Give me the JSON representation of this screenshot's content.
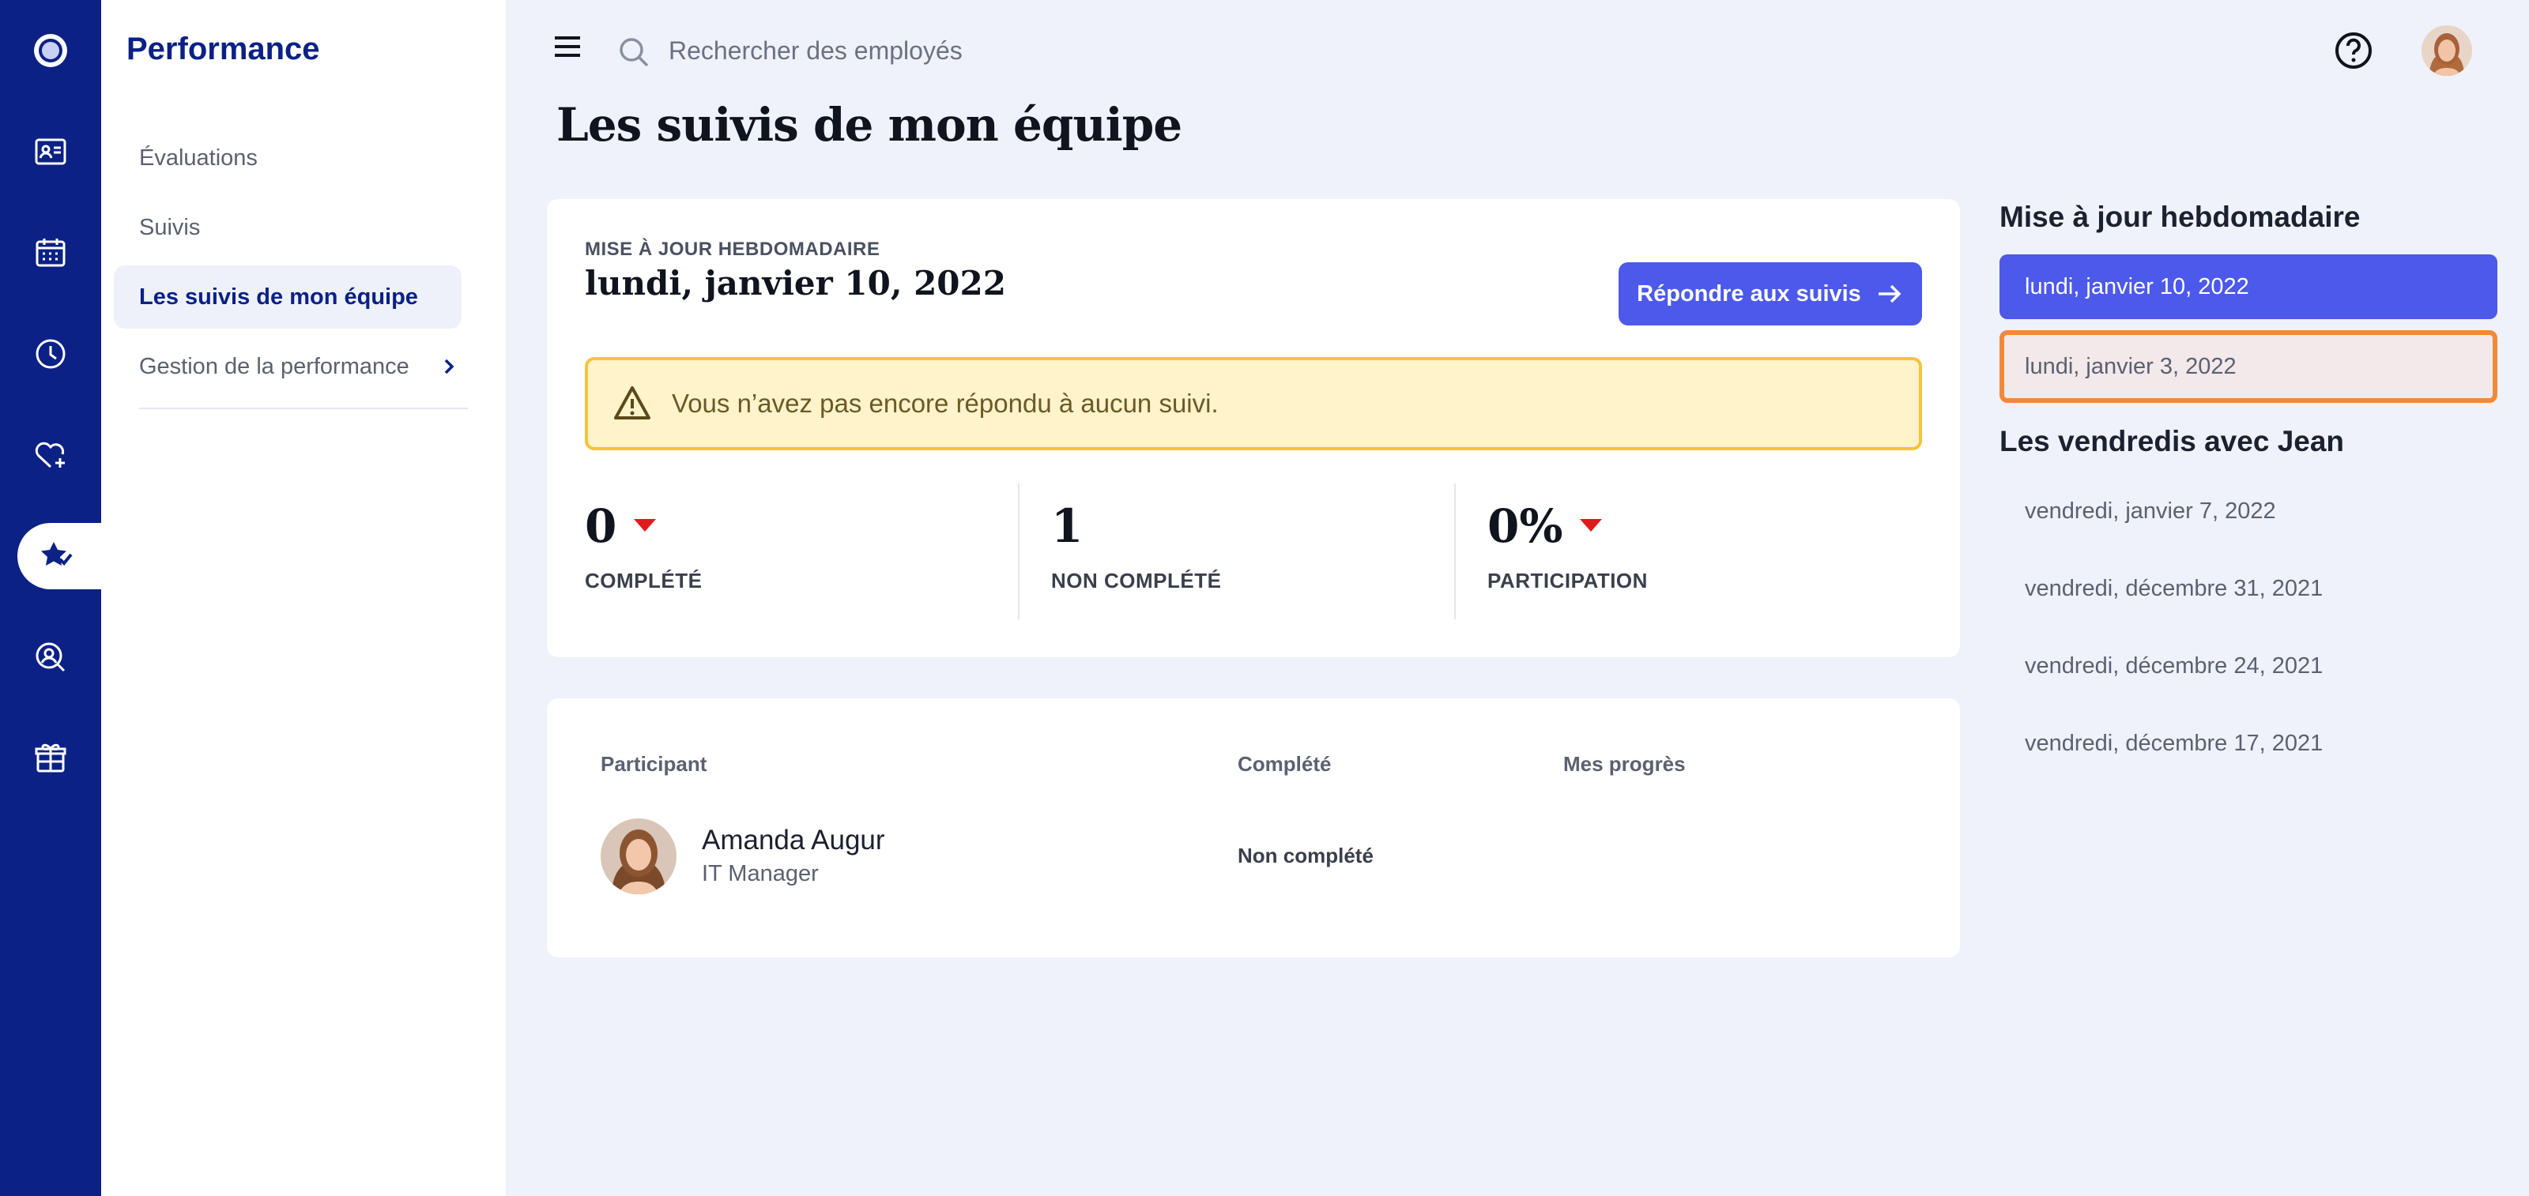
{
  "sidebar": {
    "icons": [
      "logo-icon",
      "id-card-icon",
      "calendar-icon",
      "clock-icon",
      "heart-plus-icon",
      "star-check-icon",
      "search-user-icon",
      "gift-icon"
    ],
    "active_icon": "star-check-icon"
  },
  "subnav": {
    "title": "Performance",
    "items": [
      {
        "label": "Évaluations"
      },
      {
        "label": "Suivis"
      },
      {
        "label": "Les suivis de mon équipe",
        "active": true
      },
      {
        "label": "Gestion de la performance",
        "has_submenu": true
      }
    ]
  },
  "topbar": {
    "search_placeholder": "Rechercher des employés"
  },
  "page": {
    "title": "Les suivis de mon équipe"
  },
  "summary": {
    "overline": "MISE À JOUR HEBDOMADAIRE",
    "date": "lundi, janvier 10, 2022",
    "respond_label": "Répondre aux suivis",
    "alert_text": "Vous n’avez pas encore répondu à aucun suivi.",
    "stats": [
      {
        "value": "0",
        "label": "COMPLÉTÉ",
        "trend": "down"
      },
      {
        "value": "1",
        "label": "NON COMPLÉTÉ",
        "trend": "none"
      },
      {
        "value": "0%",
        "label": "PARTICIPATION",
        "trend": "down"
      }
    ]
  },
  "table": {
    "headers": [
      "Participant",
      "Complété",
      "Mes progrès"
    ],
    "rows": [
      {
        "name": "Amanda Augur",
        "role": "IT Manager",
        "status": "Non complété",
        "progress": ""
      }
    ]
  },
  "right_panel": {
    "weekly_heading": "Mise à jour hebdomadaire",
    "weekly_items": [
      {
        "label": "lundi, janvier 10, 2022",
        "state": "selected"
      },
      {
        "label": "lundi, janvier 3, 2022",
        "state": "hover"
      }
    ],
    "friday_heading": "Les vendredis avec Jean",
    "friday_items": [
      {
        "label": "vendredi, janvier 7, 2022"
      },
      {
        "label": "vendredi, décembre 31, 2021"
      },
      {
        "label": "vendredi, décembre 24, 2021"
      },
      {
        "label": "vendredi, décembre 17, 2021"
      }
    ]
  },
  "colors": {
    "rail": "#0b2185",
    "primary": "#4c59ea",
    "alert_bg": "#fff3cc",
    "alert_border": "#f5c33b",
    "trend_down": "#e01b1b",
    "hover_border": "#f08a3a"
  }
}
